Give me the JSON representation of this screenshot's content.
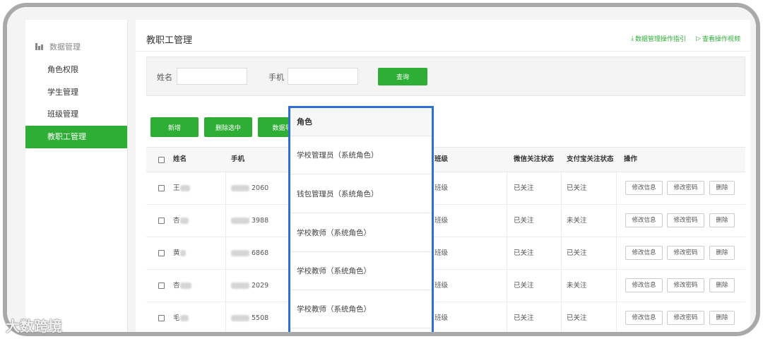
{
  "sidebar": {
    "group_label": "数据管理",
    "items": [
      {
        "label": "角色权限"
      },
      {
        "label": "学生管理"
      },
      {
        "label": "班级管理"
      },
      {
        "label": "教职工管理"
      }
    ],
    "active_index": 3
  },
  "page": {
    "title": "教职工管理",
    "links": [
      {
        "label": "数据管理操作指引",
        "icon": "download-icon"
      },
      {
        "label": "查看操作视频",
        "icon": "play-video-icon"
      }
    ]
  },
  "search": {
    "name_label": "姓名",
    "name_value": "",
    "phone_label": "手机",
    "phone_value": "",
    "query_button": "查询"
  },
  "toolbar": {
    "add": "新增",
    "delete_selected": "删除选中",
    "export": "数据导"
  },
  "table": {
    "headers": {
      "name": "姓名",
      "phone": "手机",
      "class": "班级",
      "wechat": "微信关注状态",
      "alipay": "支付宝关注状态",
      "actions": "操作"
    },
    "rows": [
      {
        "name": "王",
        "phone": "2060",
        "class": "班级",
        "wechat": "已关注",
        "alipay": "已关注"
      },
      {
        "name": "杏",
        "phone": "3988",
        "class": "班级",
        "wechat": "已关注",
        "alipay": "未关注"
      },
      {
        "name": "黄",
        "phone": "6868",
        "class": "班级",
        "wechat": "已关注",
        "alipay": "已关注"
      },
      {
        "name": "杏",
        "phone": "2029",
        "class": "班级",
        "wechat": "已关注",
        "alipay": "未关注"
      },
      {
        "name": "毛",
        "phone": "5508",
        "class": "班级",
        "wechat": "已关注",
        "alipay": "已关注"
      }
    ],
    "row_actions": {
      "edit": "修改信息",
      "password": "修改密码",
      "delete": "删除"
    }
  },
  "popup": {
    "header": "角色",
    "items": [
      "学校管理员（系统角色）",
      "钱包管理员（系统角色）",
      "学校教师（系统角色）",
      "学校教师（系统角色）",
      "学校教师（系统角色）"
    ]
  },
  "watermark": "大数跨境",
  "colors": {
    "accent": "#2eae35",
    "highlight_border": "#2f6fd1"
  }
}
